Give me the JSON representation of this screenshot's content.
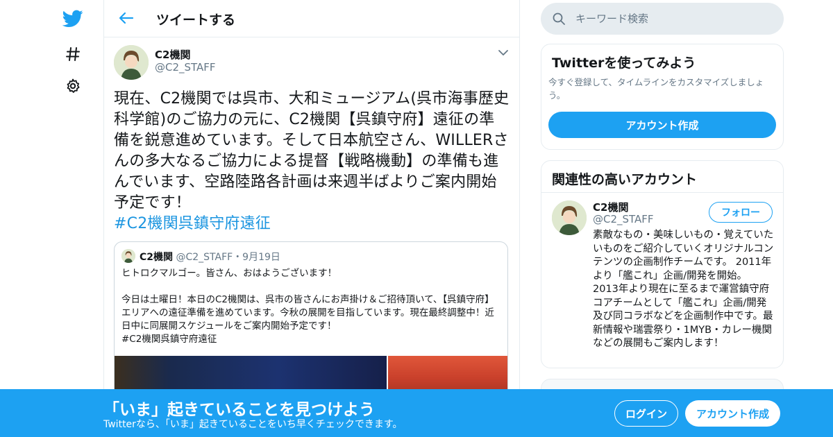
{
  "colors": {
    "brand": "#1da1f2",
    "link": "#1b95e0",
    "secondary_text": "#657786",
    "border": "#e6ecf0"
  },
  "nav": {
    "icons": [
      "twitter-logo-icon",
      "hashtag-icon",
      "gear-icon"
    ]
  },
  "header": {
    "title": "ツイートする"
  },
  "tweet": {
    "name": "C2機関",
    "handle": "@C2_STAFF",
    "text": "現在、C2機関では呉市、大和ミュージアム(呉市海事歴史科学館)のご協力の元に、C2機関【呉鎮守府】遠征の準備を鋭意進めています。そして日本航空さん、WILLERさんの多大なるご協力による提督【戦略機動】の準備も進んでいます、空路陸路各計画は来週半ばよりご案内開始予定です！",
    "hashtag": "#C2機関呉鎮守府遠征",
    "quote": {
      "name": "C2機関",
      "handle": "@C2_STAFF",
      "date": "・9月19日",
      "paragraph1": "ヒトロクマルゴー。皆さん、おはようございます！",
      "paragraph2": "今日は土曜日！本日のC2機関は、呉市の皆さんにお声掛け＆ご招待頂いて、【呉鎮守府】エリアへの遠征準備を進めています。今秋の展開を目指しています。現在最終調整中！近日中に同展開スケジュールをご案内開始予定です！",
      "hashtag": "#C2機関呉鎮守府遠征"
    }
  },
  "search": {
    "placeholder": "キーワード検索"
  },
  "signup_card": {
    "title": "Twitterを使ってみよう",
    "text": "今すぐ登録して、タイムラインをカスタマイズしましょう。",
    "button": "アカウント作成"
  },
  "related": {
    "title": "関連性の高いアカウント",
    "name": "C2機関",
    "handle": "@C2_STAFF",
    "follow": "フォロー",
    "bio": "素敵なもの・美味しいもの・覚えていたいものをご紹介していくオリジナルコンテンツの企画制作チームです。 2011年より「艦これ」企画/開発を開始。 2013年より現在に至るまで運営鎮守府コアチームとして「艦これ」企画/開発及び同コラボなどを企画制作中です。最新情報や瑞雲祭り・1MYB・カレー機関などの展開もご案内します！"
  },
  "banner": {
    "title": "「いま」起きていることを見つけよう",
    "subtitle": "Twitterなら、「いま」起きていることをいち早くチェックできます。",
    "login": "ログイン",
    "signup": "アカウント作成"
  }
}
